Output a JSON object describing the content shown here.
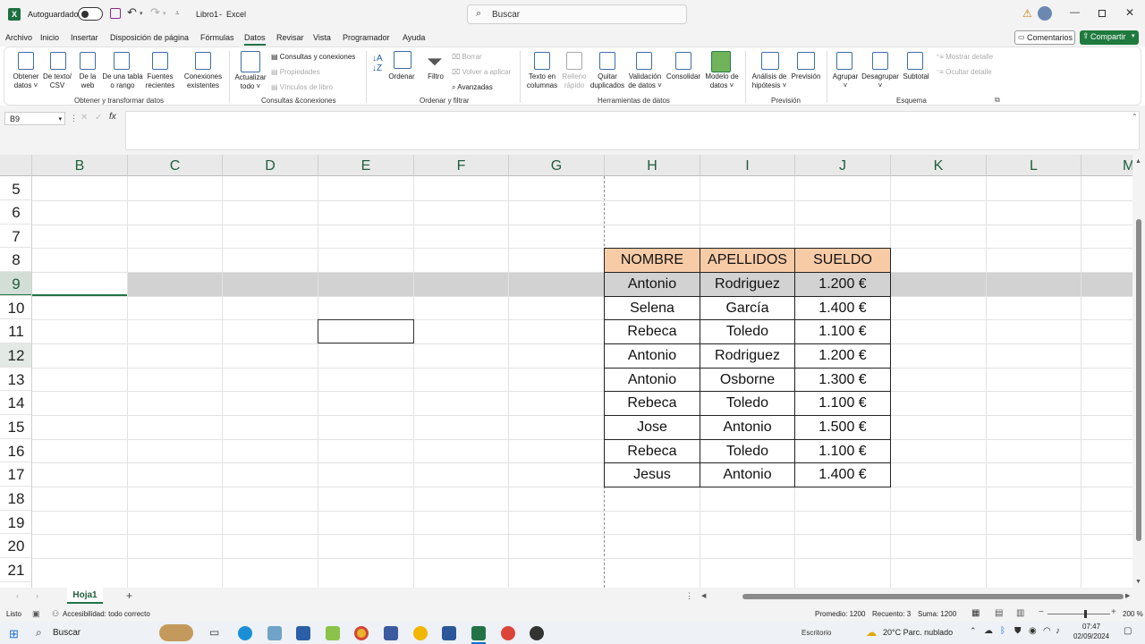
{
  "titlebar": {
    "autosave_label": "Autoguardado",
    "workbook": "Libro1",
    "app": "Excel",
    "separator": "-",
    "search_placeholder": "Buscar"
  },
  "menu": {
    "items": [
      "Archivo",
      "Inicio",
      "Insertar",
      "Disposición de página",
      "Fórmulas",
      "Datos",
      "Revisar",
      "Vista",
      "Programador",
      "Ayuda"
    ],
    "active": "Datos",
    "comments": "Comentarios",
    "share": "Compartir"
  },
  "ribbon": {
    "get_transform": {
      "group_label": "Obtener y transformar datos",
      "buttons": [
        "Obtener datos ˅",
        "De texto/ CSV",
        "De la web",
        "De una tabla o rango",
        "Fuentes recientes",
        "Conexiones existentes"
      ]
    },
    "queries": {
      "group_label": "Consultas &conexiones",
      "refresh": "Actualizar todo ˅",
      "items": [
        "Consultas y conexiones",
        "Propiedades",
        "Vínculos de libro"
      ]
    },
    "sort_filter": {
      "group_label": "Ordenar y filtrar",
      "sort": "Ordenar",
      "filter": "Filtro",
      "clear": "Borrar",
      "reapply": "Volver a aplicar",
      "advanced": "Avanzadas"
    },
    "data_tools": {
      "group_label": "Herramientas de datos",
      "buttons": [
        "Texto en columnas",
        "Relleno rápido",
        "Quitar duplicados",
        "Validación de datos ˅",
        "Consolidar",
        "Modelo de datos ˅"
      ]
    },
    "forecast": {
      "group_label": "Previsión",
      "buttons": [
        "Análisis de hipótesis ˅",
        "Previsión"
      ]
    },
    "outline": {
      "group_label": "Esquema",
      "buttons": [
        "Agrupar ˅",
        "Desagrupar ˅",
        "Subtotal"
      ],
      "show_detail": "Mostrar detalle",
      "hide_detail": "Ocultar detalle"
    }
  },
  "formula_bar": {
    "name_box": "B9",
    "fx": "fx",
    "value": ""
  },
  "grid": {
    "columns": [
      "B",
      "C",
      "D",
      "E",
      "F",
      "G",
      "H",
      "I",
      "J",
      "K",
      "L",
      "M"
    ],
    "rows": [
      "5",
      "6",
      "7",
      "8",
      "9",
      "10",
      "11",
      "12",
      "13",
      "14",
      "15",
      "16",
      "17",
      "18",
      "19",
      "20",
      "21"
    ],
    "table": {
      "headers": [
        "NOMBRE",
        "APELLIDOS",
        "SUELDO"
      ],
      "rows": [
        [
          "Antonio",
          "Rodriguez",
          "1.200 €"
        ],
        [
          "Selena",
          "García",
          "1.400 €"
        ],
        [
          "Rebeca",
          "Toledo",
          "1.100 €"
        ],
        [
          "Antonio",
          "Rodriguez",
          "1.200 €"
        ],
        [
          "Antonio",
          "Osborne",
          "1.300 €"
        ],
        [
          "Rebeca",
          "Toledo",
          "1.100 €"
        ],
        [
          "Jose",
          "Antonio",
          "1.500 €"
        ],
        [
          "Rebeca",
          "Toledo",
          "1.100 €"
        ],
        [
          "Jesus",
          "Antonio",
          "1.400 €"
        ]
      ]
    },
    "selected_row": "9"
  },
  "sheets": {
    "tabs": [
      "Hoja1"
    ],
    "add": "+"
  },
  "status": {
    "ready": "Listo",
    "accessibility": "Accesibilidad: todo correcto",
    "average": "Promedio: 1200",
    "count": "Recuento: 3",
    "sum": "Suma: 1200",
    "zoom": "200 %"
  },
  "taskbar": {
    "search": "Buscar",
    "desktop": "Escritorio",
    "weather": "20°C  Parc. nublado",
    "time": "07:47",
    "date": "02/09/2024"
  }
}
